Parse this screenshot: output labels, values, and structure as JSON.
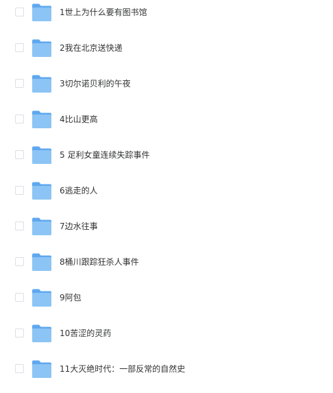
{
  "file_list": {
    "items": [
      {
        "name": "1世上为什么要有图书馆",
        "type_icon": "folder-icon"
      },
      {
        "name": "2我在北京送快递",
        "type_icon": "folder-icon"
      },
      {
        "name": "3切尔诺贝利的午夜",
        "type_icon": "folder-icon"
      },
      {
        "name": "4比山更高",
        "type_icon": "folder-icon"
      },
      {
        "name": "5 足利女童连续失踪事件",
        "type_icon": "folder-icon"
      },
      {
        "name": "6逃走的人",
        "type_icon": "folder-icon"
      },
      {
        "name": "7边水往事",
        "type_icon": "folder-icon"
      },
      {
        "name": "8桶川跟踪狂杀人事件",
        "type_icon": "folder-icon"
      },
      {
        "name": "9阿包",
        "type_icon": "folder-icon"
      },
      {
        "name": "10苦涩的灵药",
        "type_icon": "folder-icon"
      },
      {
        "name": "11大灭绝时代：一部反常的自然史",
        "type_icon": "folder-icon"
      }
    ]
  },
  "colors": {
    "folder_front": "#8cc4f5",
    "folder_back": "#5fa8ef",
    "text": "#303133",
    "checkbox_border": "#dcdfe6"
  }
}
